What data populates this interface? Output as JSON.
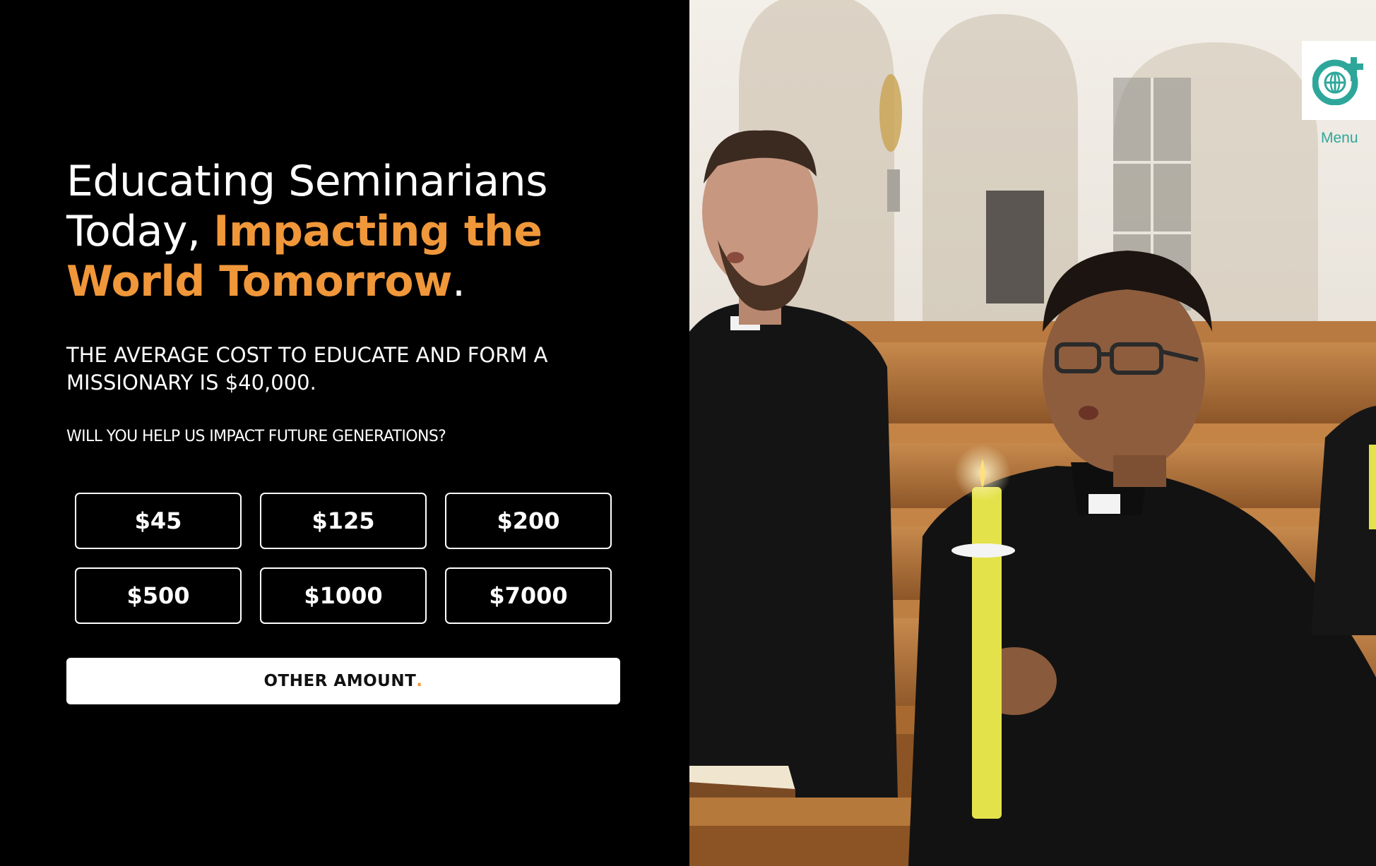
{
  "hero": {
    "headline_plain_1": "Educating Seminarians",
    "headline_plain_2": "Today, ",
    "headline_accent_1": "Impacting the",
    "headline_accent_2": "World Tomorrow",
    "headline_end": ".",
    "subhead_line1": "THE AVERAGE COST TO EDUCATE AND FORM A",
    "subhead_line2": "MISSIONARY IS $40,000.",
    "question": "WILL YOU HELP US IMPACT FUTURE GENERATIONS?"
  },
  "donation": {
    "amounts": [
      "$45",
      "$125",
      "$200",
      "$500",
      "$1000",
      "$7000"
    ],
    "other_label": "OTHER AMOUNT",
    "other_dot": "."
  },
  "nav": {
    "menu_label": "Menu",
    "logo_icon": "globe-cross-icon"
  },
  "colors": {
    "accent": "#f0973a",
    "brand_teal": "#2ea79a",
    "background": "#000000"
  }
}
